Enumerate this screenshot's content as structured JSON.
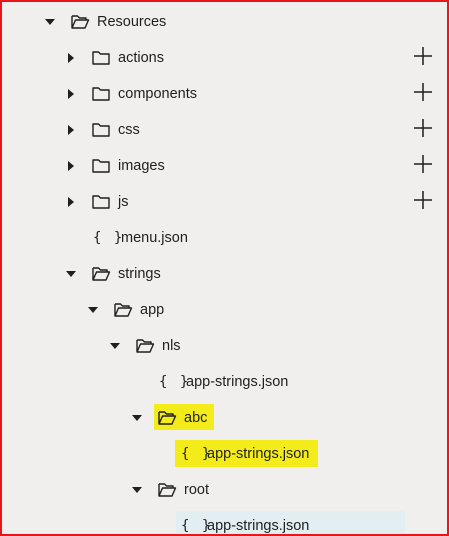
{
  "tree": {
    "resources": {
      "label": "Resources"
    },
    "actions": {
      "label": "actions"
    },
    "components": {
      "label": "components"
    },
    "css": {
      "label": "css"
    },
    "images": {
      "label": "images"
    },
    "js": {
      "label": "js"
    },
    "menu_json": {
      "label": "menu.json"
    },
    "strings": {
      "label": "strings"
    },
    "app": {
      "label": "app"
    },
    "nls": {
      "label": "nls"
    },
    "nls_app_strings": {
      "label": "app-strings.json"
    },
    "abc": {
      "label": "abc"
    },
    "abc_app_strings": {
      "label": "app-strings.json"
    },
    "root": {
      "label": "root"
    },
    "root_app_strings": {
      "label": "app-strings.json"
    }
  },
  "icons": {
    "expanded": "caret-down-icon",
    "collapsed": "caret-right-icon",
    "folder": "folder-icon",
    "folder_open": "folder-open-icon",
    "json": "json-file-icon",
    "add": "plus-icon"
  },
  "colors": {
    "background": "#f1efed",
    "border": "#e8161b",
    "highlight": "#f4ec1a",
    "selection": "#e3eef3",
    "text": "#1f1f1f"
  },
  "json_glyph": "{ }"
}
